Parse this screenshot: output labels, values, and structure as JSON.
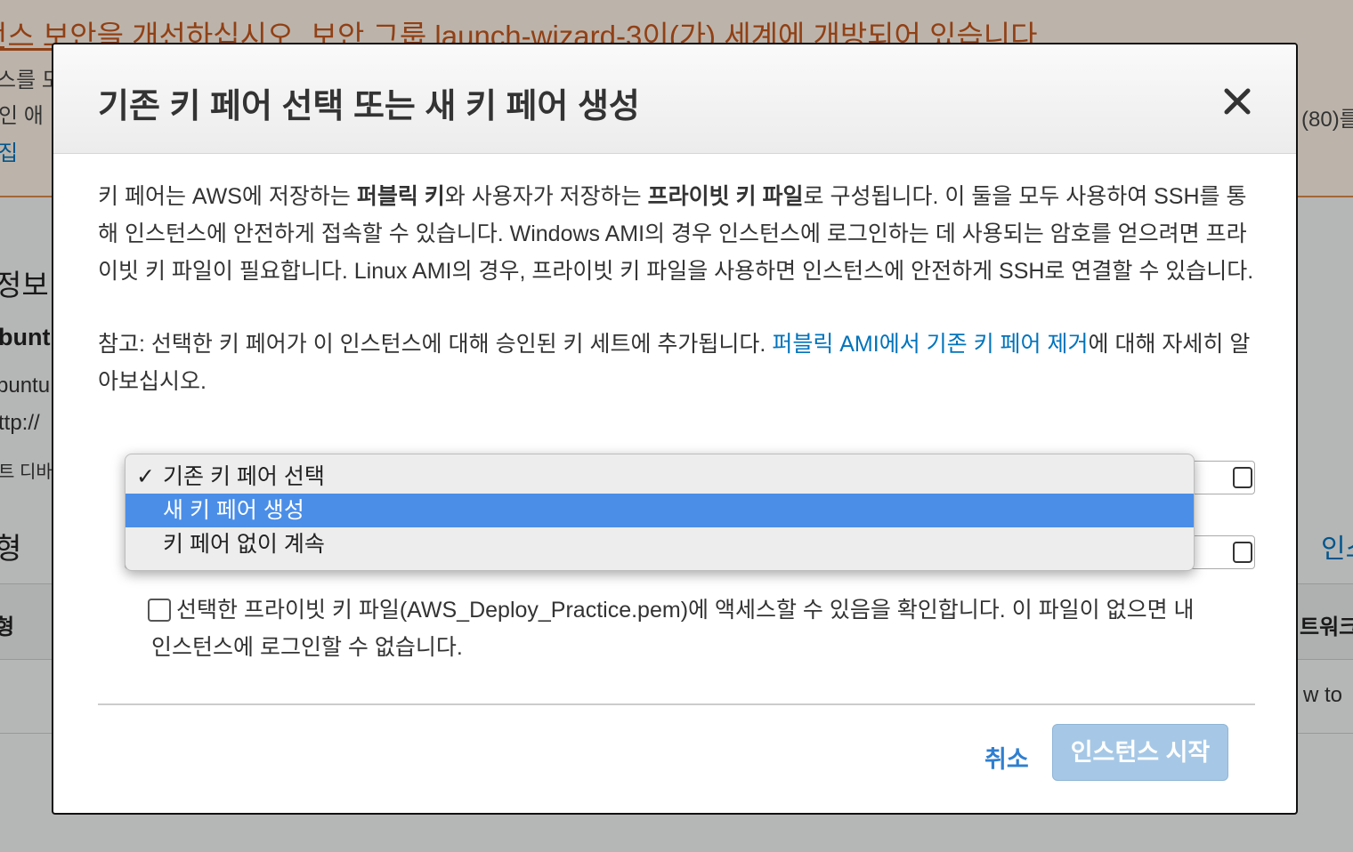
{
  "background": {
    "warning_title": "턴스 보안을 개선하십시오. 보안 그룹 launch-wizard-3이(가) 세계에 개방되어 있습니다",
    "warning_line_1": "스를 모",
    "warning_line_2": "인 애",
    "warning_line_3_right": "(80)를",
    "warning_link": "집",
    "section_heading_info": "정보",
    "bold_label": "bunt",
    "text_1": "buntu",
    "text_2": "ttp://",
    "text_3": "트 디바",
    "section_heading_type": "형",
    "right_link": "인스",
    "table_header_left": "형",
    "table_header_right": "트워크",
    "row_text_right": "w to"
  },
  "modal": {
    "title": "기존 키 페어 선택 또는 새 키 페어 생성",
    "close_symbol": "✕",
    "intro": {
      "part1": "키 페어는 AWS에 저장하는 ",
      "bold1": "퍼블릭 키",
      "part2": "와 사용자가 저장하는 ",
      "bold2": "프라이빗 키 파일",
      "part3": "로 구성됩니다. 이 둘을 모두 사용하여 SSH를 통해 인스턴스에 안전하게 접속할 수 있습니다. Windows AMI의 경우 인스턴스에 로그인하는 데 사용되는 암호를 얻으려면 프라이빗 키 파일이 필요합니다. Linux AMI의 경우, 프라이빗 키 파일을 사용하면 인스턴스에 안전하게 SSH로 연결할 수 있습니다."
    },
    "note": {
      "before": "참고: 선택한 키 페어가 이 인스턴스에 대해 승인된 키 세트에 추가됩니다. ",
      "link": "퍼블릭 AMI에서 기존 키 페어 제거",
      "after": "에 대해 자세히 알아보십시오."
    },
    "dropdown": {
      "check_mark": "✓",
      "options": [
        "기존 키 페어 선택",
        "새 키 페어 생성",
        "키 페어 없이 계속"
      ],
      "checked_index": 0,
      "highlighted_index": 1
    },
    "acknowledge": {
      "checked": false,
      "text": "선택한 프라이빗 키 파일(AWS_Deploy_Practice.pem)에 액세스할 수 있음을 확인합니다. 이 파일이 없으면 내 인스턴스에 로그인할 수 없습니다."
    },
    "cancel_label": "취소",
    "launch_label": "인스턴스 시작"
  },
  "colors": {
    "accent_link": "#0073bb",
    "highlight": "#4b8ee8",
    "launch_button_disabled": "#a6c8e6",
    "warning_text": "#c2561c"
  }
}
